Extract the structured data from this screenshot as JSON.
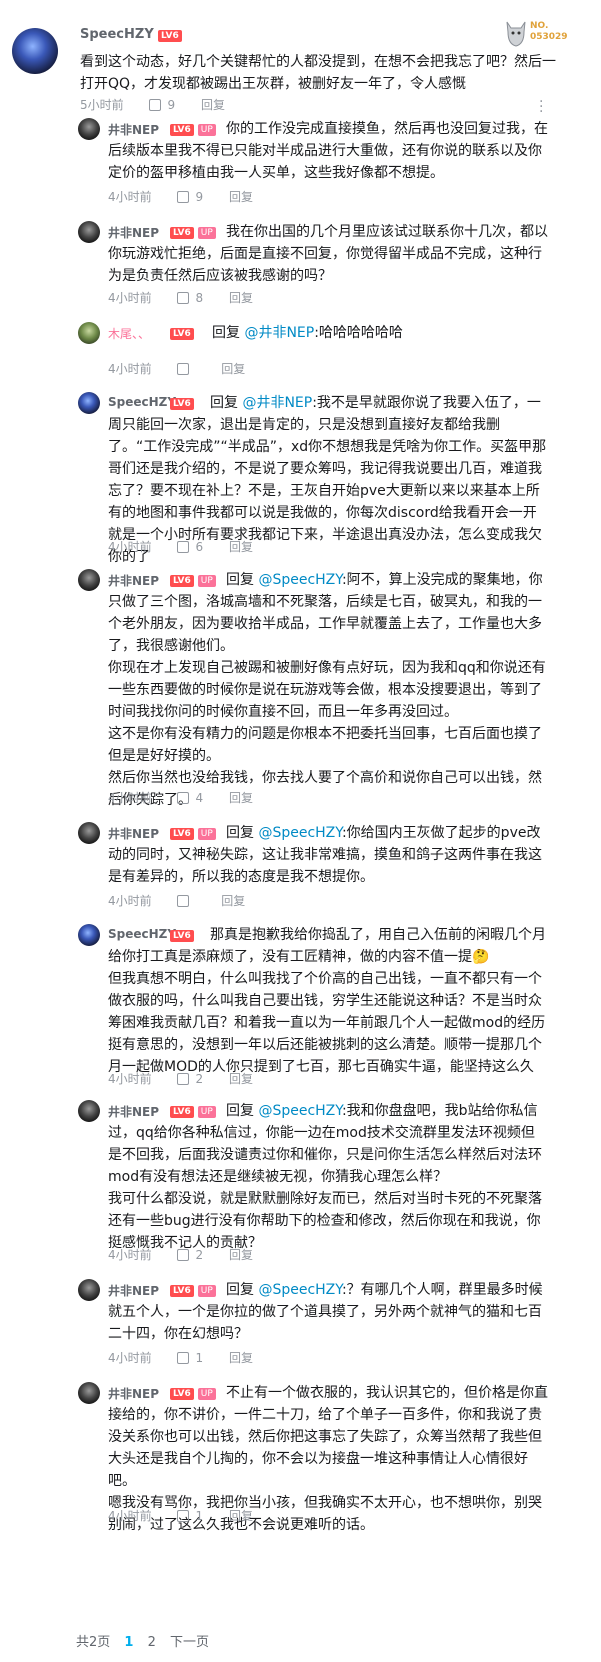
{
  "main": {
    "username": "SpeecHZY",
    "level": "LV6",
    "fan_badge": {
      "title": "NO.",
      "number": "053029"
    },
    "text": "看到这个动态，好几个关键帮忙的人都没提到，在想不会把我忘了吧？然后一打开QQ，才发现都被踢出王灰群，被删好友一年了，令人感慨",
    "time": "5小时前",
    "likes": "9",
    "reply_label": "回复"
  },
  "replies": [
    {
      "user": "井非NEP",
      "level": "LV6",
      "up": "UP",
      "text": "你的工作没完成直接摸鱼，然后再也没回复过我，在后续版本里我不得已只能对半成品进行大重做，还有你说的联系以及你定价的盔甲移植由我一人买单，这些我好像都不想提。",
      "time": "4小时前",
      "likes": "9",
      "reply_label": "回复"
    },
    {
      "user": "井非NEP",
      "level": "LV6",
      "up": "UP",
      "text": "我在你出国的几个月里应该试过联系你十几次，都以你玩游戏忙拒绝，后面是直接不回复，你觉得留半成品不完成，这种行为是负责任然后应该被我感谢的吗？",
      "time": "4小时前",
      "likes": "8",
      "reply_label": "回复"
    },
    {
      "user": "木尾、、",
      "level": "LV6",
      "reply_prefix": "回复",
      "at": "@井非NEP",
      "text": ":哈哈哈哈哈哈",
      "time": "4小时前",
      "likes": "",
      "reply_label": "回复"
    },
    {
      "user": "SpeecHZY",
      "level": "LV6",
      "reply_prefix": "回复",
      "at": "@井非NEP",
      "text": ":我不是早就跟你说了我要入伍了，一周只能回一次家，退出是肯定的，只是没想到直接好友都给我删了。“工作没完成”“半成品”，xd你不想想我是凭啥为你工作。买盔甲那哥们还是我介绍的，不是说了要众筹吗，我记得我说要出几百，难道我忘了？要不现在补上？不是，王灰自开始pve大更新以来以来基本上所有的地图和事件我都可以说是我做的，你每次discord给我看开会一开就是一个小时所有要求我都记下来，半途退出真没办法，怎么变成我欠你的了",
      "time": "4小时前",
      "likes": "6",
      "reply_label": "回复"
    },
    {
      "user": "井非NEP",
      "level": "LV6",
      "up": "UP",
      "reply_prefix": "回复",
      "at": "@SpeecHZY",
      "text": ":阿不，算上没完成的聚集地，你只做了三个图，洛城高墙和不死聚落，后续是七百，破冥丸，和我的一个老外朋友，因为要收拾半成品，工作早就覆盖上去了，工作量也大多了，我很感谢他们。\n你现在才上发现自己被踢和被删好像有点好玩，因为我和qq和你说还有一些东西要做的时候你是说在玩游戏等会做，根本没搜要退出，等到了时间我找你问的时候你直接不回，而且一年多再没回过。\n这不是你有没有精力的问题是你根本不把委托当回事，七百后面也摸了但是是好好摸的。\n然后你当然也没给我钱，你去找人要了个高价和说你自己可以出钱，然后你失踪了。",
      "time": "4小时前",
      "likes": "4",
      "reply_label": "回复"
    },
    {
      "user": "井非NEP",
      "level": "LV6",
      "up": "UP",
      "reply_prefix": "回复",
      "at": "@SpeecHZY",
      "text": ":你给国内王灰做了起步的pve改动的同时，又神秘失踪，这让我非常难搞，摸鱼和鸽子这两件事在我这是有差异的，所以我的态度是我不想提你。",
      "time": "4小时前",
      "likes": "",
      "reply_label": "回复"
    },
    {
      "user": "SpeecHZY",
      "level": "LV6",
      "text": "那真是抱歉我给你捣乱了，用自己入伍前的闲暇几个月给你打工真是添麻烦了，没有工匠精神，做的内容不值一提🤔\n但我真想不明白，什么叫我找了个价高的自己出钱，一直不都只有一个做衣服的吗，什么叫我自己要出钱，穷学生还能说这种话？不是当时众筹困难我贡献几百？和着我一直以为一年前跟几个人一起做mod的经历挺有意思的，没想到一年以后还能被挑刺的这么清楚。顺带一提那几个月一起做MOD的人你只提到了七百，那七百确实牛逼，能坚持这么久",
      "time": "4小时前",
      "likes": "2",
      "reply_label": "回复"
    },
    {
      "user": "井非NEP",
      "level": "LV6",
      "up": "UP",
      "reply_prefix": "回复",
      "at": "@SpeecHZY",
      "text": ":我和你盘盘吧，我b站给你私信过，qq给你各种私信过，你能一边在mod技术交流群里发法环视频但是不回我，后面我没谴责过你和催你，只是问你生活怎么样然后对法环mod有没有想法还是继续被无视，你猜我心理怎么样？\n我可什么都没说，就是默默删除好友而已，然后对当时卡死的不死聚落还有一些bug进行没有你帮助下的检查和修改，然后你现在和我说，你挺感慨我不记人的贡献？",
      "time": "4小时前",
      "likes": "2",
      "reply_label": "回复"
    },
    {
      "user": "井非NEP",
      "level": "LV6",
      "up": "UP",
      "reply_prefix": "回复",
      "at": "@SpeecHZY",
      "text": ":？有哪几个人啊，群里最多时候就五个人，一个是你拉的做了个道具摸了，另外两个就神气的猫和七百二十四，你在幻想吗？",
      "time": "4小时前",
      "likes": "1",
      "reply_label": "回复"
    },
    {
      "user": "井非NEP",
      "level": "LV6",
      "up": "UP",
      "text": "不止有一个做衣服的，我认识其它的，但价格是你直接给的，你不讲价，一件二十刀，给了个单子一百多件，你和我说了贵没关系你也可以出钱，然后你把这事忘了失踪了，众筹当然帮了我些但大头还是我自个儿掏的，你不会以为接盘一堆这种事情让人心情很好吧。\n嗯我没有骂你，我把你当小孩，但我确实不太开心，也不想哄你，别哭别闹，过了这么久我也不会说更难听的话。",
      "time": "4小时前",
      "likes": "1",
      "reply_label": "回复"
    }
  ],
  "pager": {
    "total": "共2页",
    "page1": "1",
    "page2": "2",
    "next": "下一页"
  }
}
